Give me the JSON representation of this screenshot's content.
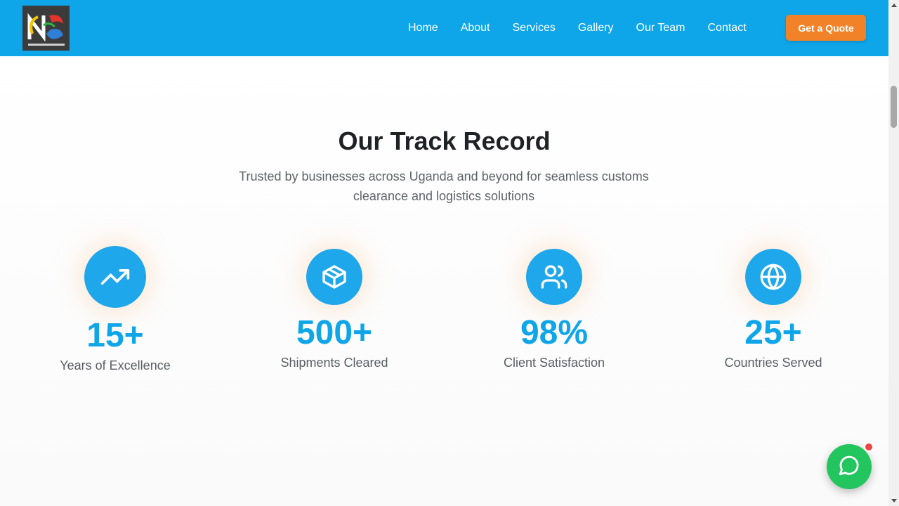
{
  "header": {
    "logo_icon": "company-logo",
    "nav": [
      {
        "label": "Home"
      },
      {
        "label": "About"
      },
      {
        "label": "Services"
      },
      {
        "label": "Gallery"
      },
      {
        "label": "Our Team"
      },
      {
        "label": "Contact"
      }
    ],
    "cta_label": "Get a Quote"
  },
  "track_record": {
    "title": "Our Track Record",
    "subtitle": "Trusted by businesses across Uganda and beyond for seamless customs clearance and logistics solutions",
    "stats": [
      {
        "icon": "trending-up-icon",
        "value": "15+",
        "label": "Years of Excellence"
      },
      {
        "icon": "package-icon",
        "value": "500+",
        "label": "Shipments Cleared"
      },
      {
        "icon": "users-icon",
        "value": "98%",
        "label": "Client Satisfaction"
      },
      {
        "icon": "globe-icon",
        "value": "25+",
        "label": "Countries Served"
      }
    ]
  },
  "chat": {
    "icon": "chat-icon"
  },
  "colors": {
    "header": "#0ea5e9",
    "cta": "#f28227",
    "stat_number": "#0ea5e9",
    "chat": "#22c55e"
  }
}
